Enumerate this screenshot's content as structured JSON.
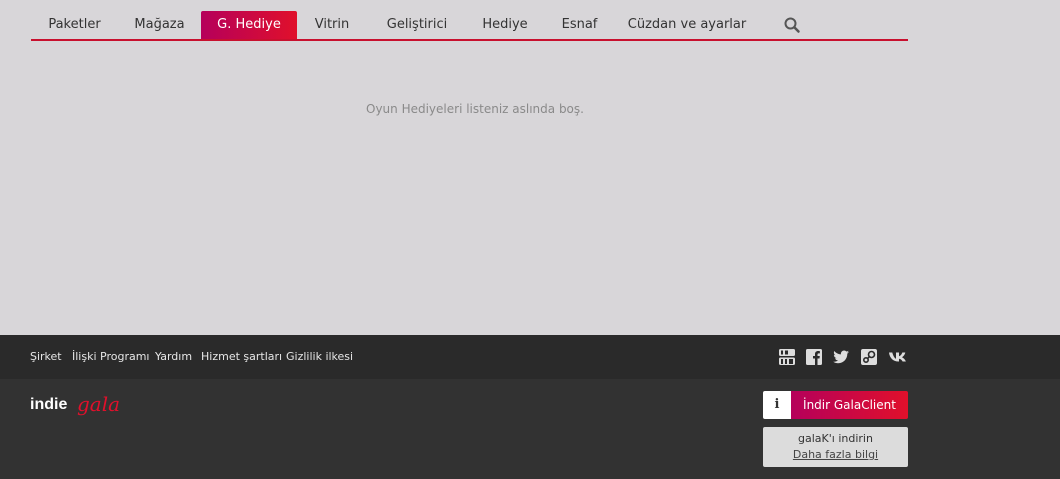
{
  "nav": {
    "items": [
      {
        "label": "Paketler",
        "active": false
      },
      {
        "label": "Mağaza",
        "active": false
      },
      {
        "label": "G. Hediye",
        "active": true
      },
      {
        "label": "Vitrin",
        "active": false
      },
      {
        "label": "Geliştirici",
        "active": false
      },
      {
        "label": "Hediye",
        "active": false
      },
      {
        "label": "Esnaf",
        "active": false
      },
      {
        "label": "Cüzdan ve ayarlar",
        "active": false
      }
    ],
    "search_icon": "search-icon"
  },
  "main": {
    "empty_message": "Oyun Hediyeleri listeniz aslında boş."
  },
  "footer": {
    "links": [
      "Şirket",
      "İlişki Programı",
      "Yardım",
      "Hizmet şartları",
      "Gizlilik ilkesi"
    ],
    "social_icons": [
      "youtube-icon",
      "facebook-icon",
      "twitter-icon",
      "steam-icon",
      "vk-icon"
    ],
    "logo": {
      "part1": "indie",
      "part2": "gala"
    },
    "download": {
      "info_symbol": "i",
      "label": "İndir GalaClient"
    },
    "info_box": {
      "title": "galaK'ı indirin",
      "link": "Daha fazla bilgi"
    }
  },
  "colors": {
    "accent_start": "#b5005b",
    "accent_end": "#e0102b",
    "nav_line": "#c8102e"
  }
}
